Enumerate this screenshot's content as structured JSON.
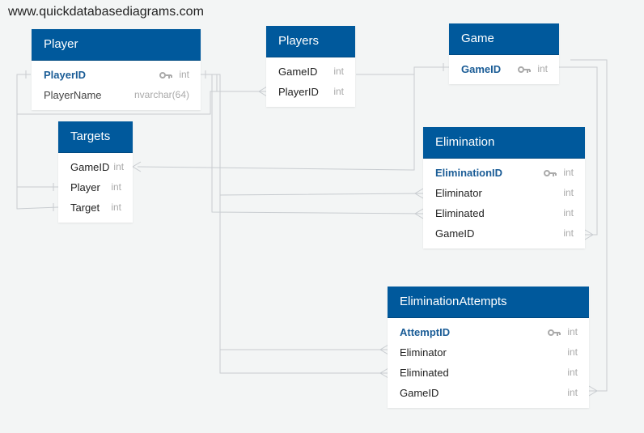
{
  "watermark": "www.quickdatabasediagrams.com",
  "tables": {
    "player": {
      "title": "Player",
      "fields": [
        {
          "name": "PlayerID",
          "type": "int"
        },
        {
          "name": "PlayerName",
          "type": "nvarchar(64)"
        }
      ]
    },
    "players": {
      "title": "Players",
      "fields": [
        {
          "name": "GameID",
          "type": "int"
        },
        {
          "name": "PlayerID",
          "type": "int"
        }
      ]
    },
    "game": {
      "title": "Game",
      "fields": [
        {
          "name": "GameID",
          "type": "int"
        }
      ]
    },
    "targets": {
      "title": "Targets",
      "fields": [
        {
          "name": "GameID",
          "type": "int"
        },
        {
          "name": "Player",
          "type": "int"
        },
        {
          "name": "Target",
          "type": "int"
        }
      ]
    },
    "elimination": {
      "title": "Elimination",
      "fields": [
        {
          "name": "EliminationID",
          "type": "int"
        },
        {
          "name": "Eliminator",
          "type": "int"
        },
        {
          "name": "Eliminated",
          "type": "int"
        },
        {
          "name": "GameID",
          "type": "int"
        }
      ]
    },
    "eliminationattempts": {
      "title": "EliminationAttempts",
      "fields": [
        {
          "name": "AttemptID",
          "type": "int"
        },
        {
          "name": "Eliminator",
          "type": "int"
        },
        {
          "name": "Eliminated",
          "type": "int"
        },
        {
          "name": "GameID",
          "type": "int"
        }
      ]
    }
  },
  "colors": {
    "header": "#00599c",
    "primary_key_text": "#1a5c96",
    "connector": "#c8ccd0",
    "background": "#f3f5f5"
  }
}
